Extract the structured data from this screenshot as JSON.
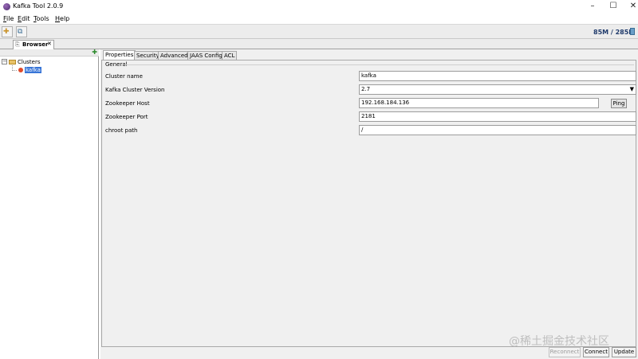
{
  "window": {
    "title": "Kafka Tool  2.0.9",
    "controls": {
      "minimize": "–",
      "maximize": "☐",
      "close": "✕"
    }
  },
  "menu": {
    "items": [
      {
        "mnemonic": "F",
        "rest": "ile"
      },
      {
        "mnemonic": "E",
        "rest": "dit"
      },
      {
        "mnemonic": "T",
        "rest": "ools"
      },
      {
        "mnemonic": "H",
        "rest": "elp"
      }
    ]
  },
  "toolbar": {
    "memory": "85M / 285M",
    "icons": [
      "add-cluster-icon",
      "manage-icon",
      "trash-icon"
    ]
  },
  "doc_tab": {
    "label": "Browser",
    "close": "✕"
  },
  "tree": {
    "root": {
      "label": "Clusters",
      "toggle": "−"
    },
    "children": [
      {
        "label": "kafka"
      }
    ]
  },
  "tabs": [
    "Properties",
    "Security",
    "Advanced",
    "JAAS Config",
    "ACL"
  ],
  "general": {
    "group_label": "General",
    "fields": {
      "cluster_name": {
        "label": "Cluster name",
        "value": "kafka"
      },
      "version": {
        "label": "Kafka Cluster Version",
        "value": "2.7"
      },
      "zk_host": {
        "label": "Zookeeper Host",
        "value": "192.168.184.136"
      },
      "zk_port": {
        "label": "Zookeeper Port",
        "value": "2181"
      },
      "chroot": {
        "label": "chroot path",
        "value": "/"
      }
    },
    "ping_label": "Ping"
  },
  "buttons": {
    "reconnect": "Reconnect",
    "connect": "Connect",
    "update": "Update"
  },
  "watermark": "@稀土掘金技术社区",
  "colors": {
    "selection": "#3875d7",
    "status_icon": "#e14a2b"
  }
}
